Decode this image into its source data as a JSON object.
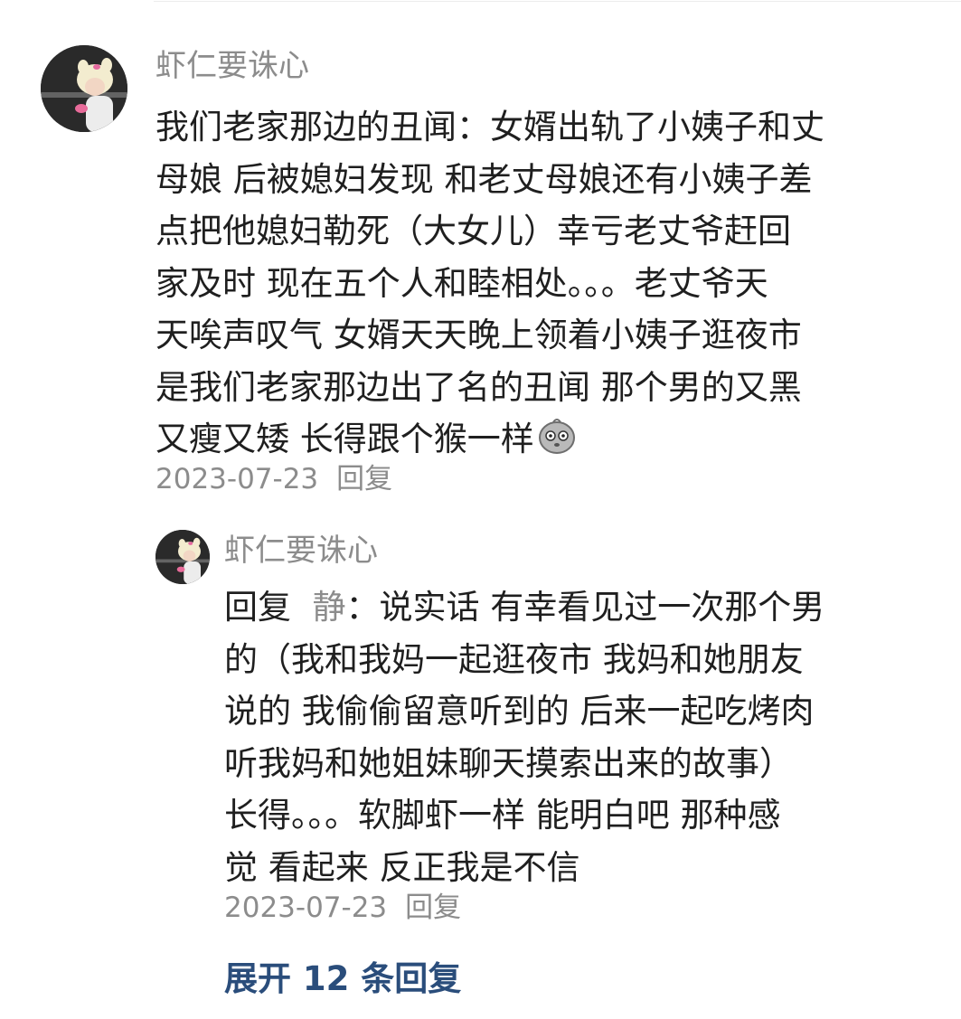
{
  "comment": {
    "username": "虾仁要诛心",
    "lines": [
      "我们老家那边的丑闻：女婿出轨了小姨子和丈",
      "母娘 后被媳妇发现  和老丈母娘还有小姨子差",
      "点把他媳妇勒死（大女儿）幸亏老丈爷赶回",
      "家及时 现在五个人和睦相处。。。老丈爷天",
      "天唉声叹气 女婿天天晚上领着小姨子逛夜市",
      "是我们老家那边出了名的丑闻 那个男的又黑",
      "又瘦又矮 长得跟个猴一样"
    ],
    "emoji": "speechless-face-icon",
    "date": "2023-07-23",
    "reply_label": "回复"
  },
  "reply": {
    "username": "虾仁要诛心",
    "prefix": "回复",
    "target": "静",
    "first_line_rest": "：说实话 有幸看见过一次那个男",
    "lines": [
      "的（我和我妈一起逛夜市 我妈和她朋友",
      "说的 我偷偷留意听到的 后来一起吃烤肉",
      "听我妈和她姐妹聊天摸索出来的故事）",
      "长得。。。软脚虾一样 能明白吧 那种感",
      "觉 看起来 反正我是不信"
    ],
    "date": "2023-07-23",
    "reply_label": "回复"
  },
  "expand_replies": "展开 12 条回复",
  "colors": {
    "username": "#8c8c8c",
    "text": "#1f1f1f",
    "meta": "#8c8c8c",
    "expand_link": "#2a4d7b"
  }
}
